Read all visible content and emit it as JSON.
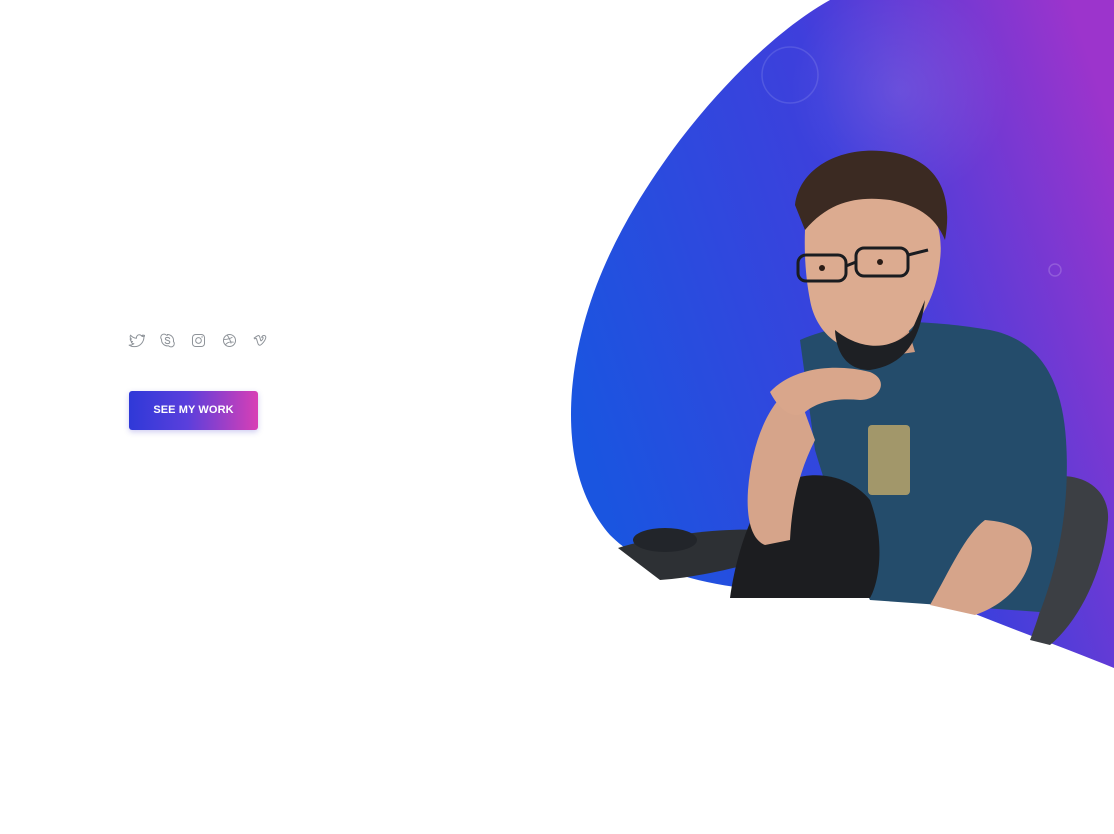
{
  "hero": {
    "cta_label": "SEE MY WORK",
    "gradient_colors": [
      "#1c4fe0",
      "#5a35d8",
      "#a632c9"
    ],
    "button_gradient": [
      "#2f39d8",
      "#d83fb5"
    ]
  },
  "social": {
    "items": [
      {
        "name": "twitter",
        "icon": "twitter-icon"
      },
      {
        "name": "skype",
        "icon": "skype-icon"
      },
      {
        "name": "instagram",
        "icon": "instagram-icon"
      },
      {
        "name": "dribbble",
        "icon": "dribbble-icon"
      },
      {
        "name": "vimeo",
        "icon": "vimeo-icon"
      }
    ],
    "icon_color": "#8e9399"
  }
}
